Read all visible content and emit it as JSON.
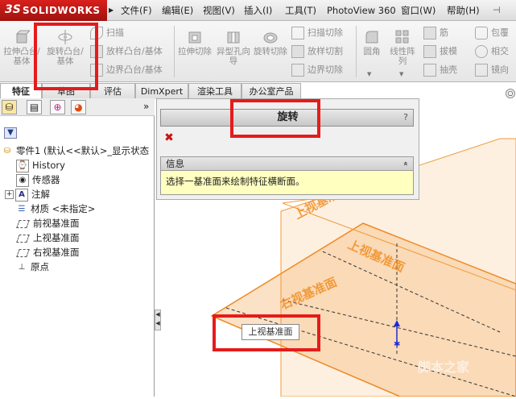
{
  "app": {
    "logo_mark": "3S",
    "logo_text": "SOLIDWORKS"
  },
  "menu": [
    {
      "label": "文件(F)"
    },
    {
      "label": "编辑(E)"
    },
    {
      "label": "视图(V)"
    },
    {
      "label": "插入(I)"
    },
    {
      "label": "工具(T)"
    },
    {
      "label": "PhotoView 360"
    },
    {
      "label": "窗口(W)"
    },
    {
      "label": "帮助(H)"
    }
  ],
  "commands": {
    "extrude_boss": "拉伸凸台/基体",
    "revolve_boss": "旋转凸台/基体",
    "sweep": "扫描",
    "loft": "放样凸台/基体",
    "boundary": "边界凸台/基体",
    "extrude_cut": "拉伸切除",
    "hole_wizard": "异型孔向导",
    "revolve_cut": "旋转切除",
    "swept_cut": "扫描切除",
    "lofted_cut": "放样切割",
    "boundary_cut": "边界切除",
    "fillet": "圆角",
    "linear_pattern": "线性阵列",
    "rib": "筋",
    "draft": "拔模",
    "shell": "抽壳",
    "wrap": "包覆",
    "intersect": "相交",
    "mirror": "镜向"
  },
  "tabs": [
    {
      "label": "特征"
    },
    {
      "label": "草图"
    },
    {
      "label": "评估"
    },
    {
      "label": "DimXpert"
    },
    {
      "label": "渲染工具"
    },
    {
      "label": "办公室产品"
    }
  ],
  "panel": {
    "more": "»",
    "tree": {
      "root": "零件1 (默认<<默认>_显示状态",
      "items": [
        {
          "label": "History",
          "icon": "history-icon"
        },
        {
          "label": "传感器",
          "icon": "sensor-icon"
        },
        {
          "label": "注解",
          "icon": "annotation-icon"
        },
        {
          "label": "材质 <未指定>",
          "icon": "material-icon"
        },
        {
          "label": "前视基准面",
          "icon": "plane-icon"
        },
        {
          "label": "上视基准面",
          "icon": "plane-icon"
        },
        {
          "label": "右视基准面",
          "icon": "plane-icon"
        },
        {
          "label": "原点",
          "icon": "origin-icon"
        }
      ]
    }
  },
  "property_manager": {
    "title": "旋转",
    "help": "?",
    "close": "✖",
    "info_title": "信息",
    "info_toggle": "«",
    "message": "选择一基准面来绘制特征横断面。"
  },
  "viewport": {
    "tooltip": "上视基准面",
    "plane_labels": [
      "上视基准面",
      "上视基准面",
      "右视基准面"
    ],
    "watermark": "脚本之家"
  },
  "colors": {
    "accent": "#e8861a",
    "plane_fill": "#f6c998",
    "highlight_box": "#e51b1b",
    "info_bg": "#ffffbf"
  }
}
